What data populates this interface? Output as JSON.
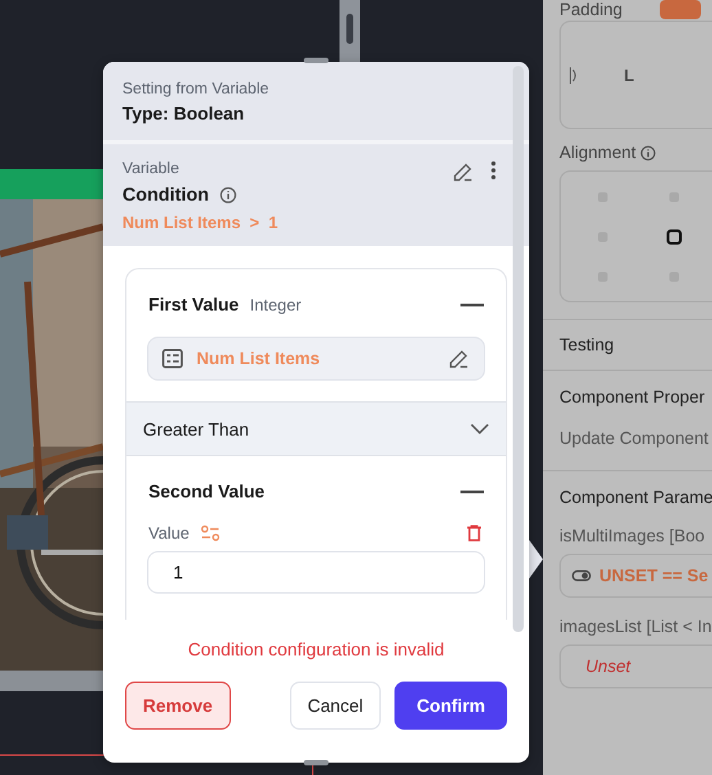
{
  "dialog": {
    "subtitle": "Setting from Variable",
    "title": "Type: Boolean",
    "variable": {
      "label": "Variable",
      "name": "Condition",
      "expression": "Num List Items  >  1"
    },
    "first_value": {
      "title": "First Value",
      "type": "Integer",
      "source": "Num List Items"
    },
    "operator": "Greater Than",
    "second_value": {
      "title": "Second Value",
      "field_label": "Value",
      "value": "1"
    },
    "error": "Condition configuration is invalid",
    "buttons": [
      {
        "label": "Remove",
        "kind": "danger"
      },
      {
        "label": "Cancel",
        "kind": "secondary"
      },
      {
        "label": "Confirm",
        "kind": "primary"
      }
    ]
  },
  "properties_panel": {
    "padding_label": "Padding",
    "padding_side": "L",
    "alignment_label": "Alignment",
    "alignment_cells": [
      {
        "selected": false
      },
      {
        "selected": false
      },
      {
        "selected": false
      },
      {
        "selected": true
      },
      {
        "selected": false
      },
      {
        "selected": false
      }
    ],
    "testing": "Testing",
    "component_properties": "Component Proper",
    "update_component": "Update Component",
    "component_parameters": "Component Parame",
    "parameters": [
      {
        "name": "isMultiImages",
        "type": "[Boo",
        "value": "UNSET == Se",
        "kind": "expression"
      },
      {
        "name": "imagesList",
        "type": "[List < In",
        "value": "Unset",
        "kind": "unset"
      }
    ]
  }
}
